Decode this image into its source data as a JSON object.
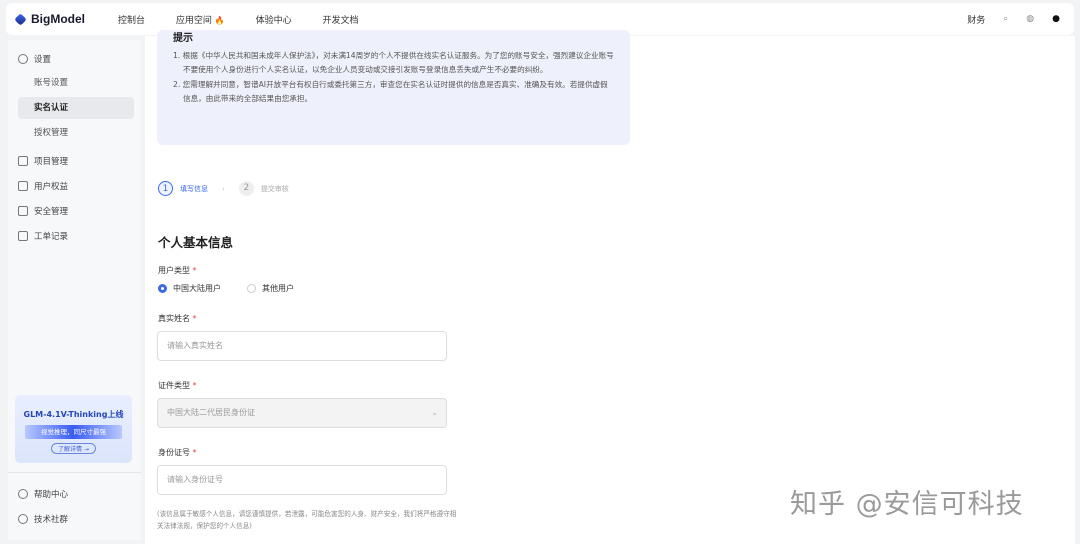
{
  "header": {
    "brand": "BigModel",
    "nav": [
      "控制台",
      "应用空间",
      "体验中心",
      "开发文档"
    ],
    "fire_icon": "🔥",
    "finance": "财务"
  },
  "sidebar": {
    "settings": "设置",
    "sub": [
      "账号设置",
      "实名认证",
      "授权管理"
    ],
    "items": [
      "项目管理",
      "用户权益",
      "安全管理",
      "工单记录"
    ],
    "promo": {
      "title": "GLM-4.1V-Thinking上线",
      "banner": "视觉推理，同尺寸最强",
      "link": "了解详情 →"
    },
    "help": "帮助中心",
    "community": "技术社群"
  },
  "notice": {
    "title": "提示",
    "items": [
      "1. 根据《中华人民共和国未成年人保护法》，对未满14周岁的个人不提供在线实名认证服务。为了您的账号安全，强烈建议企业账号不要使用个人身份进行个人实名认证，以免企业人员变动或交接引发账号登录信息丢失或产生不必要的纠纷。",
      "2. 您需理解并同意，智谱AI开放平台有权自行或委托第三方，审查您在实名认证时提供的信息是否真实、准确及有效。若提供虚假信息，由此带来的全部结果由您承担。"
    ]
  },
  "steps": [
    {
      "num": "1",
      "label": "填写信息"
    },
    {
      "num": "2",
      "label": "提交审核"
    }
  ],
  "form": {
    "title": "个人基本信息",
    "user_type_label": "用户类型",
    "user_types": [
      "中国大陆用户",
      "其他用户"
    ],
    "name_label": "真实姓名",
    "name_placeholder": "请输入真实姓名",
    "id_type_label": "证件类型",
    "id_type_value": "中国大陆二代居民身份证",
    "id_label": "身份证号",
    "id_placeholder": "请输入身份证号",
    "required": "*",
    "hint": "(该信息属于敏感个人信息，请您谨慎提供，若泄露，可能危害您的人身、财产安全，我们将严格遵守相关法律法规，保护您的个人信息)"
  },
  "watermark": "知乎 @安信可科技"
}
